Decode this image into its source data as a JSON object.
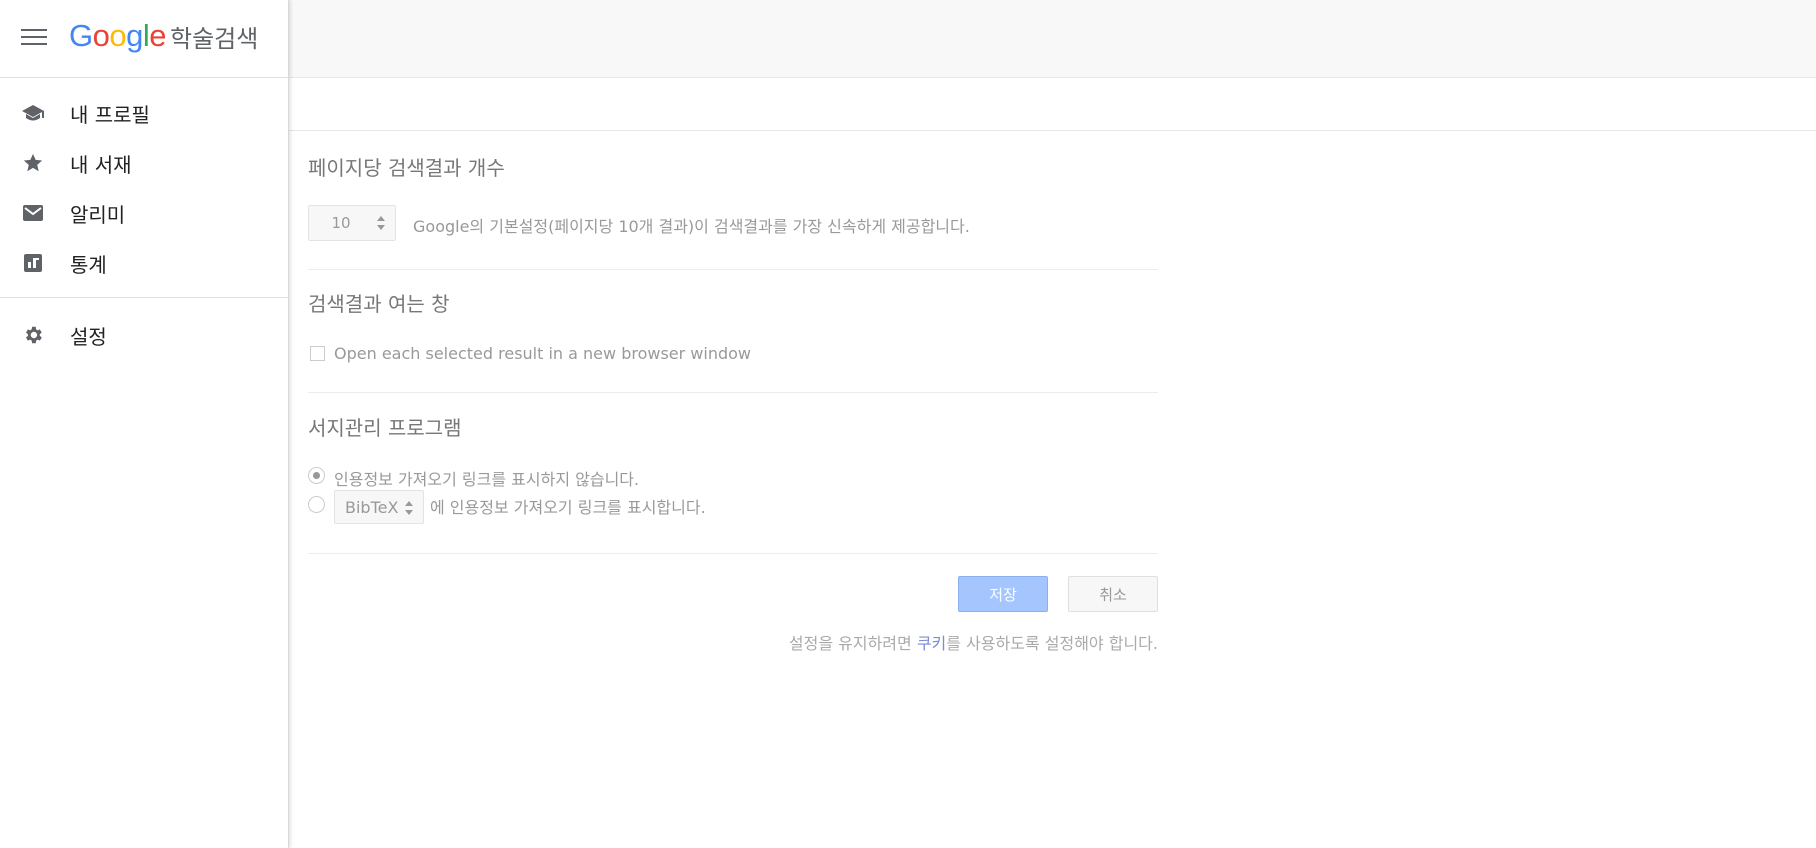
{
  "sidebar": {
    "logo": {
      "google": [
        "G",
        "o",
        "o",
        "g",
        "l",
        "e"
      ],
      "google_colors": [
        "#4285f4",
        "#ea4335",
        "#fbbc05",
        "#4285f4",
        "#34a853",
        "#ea4335"
      ],
      "product": "학술검색"
    },
    "items": [
      {
        "label": "내 프로필",
        "icon": "graduation-cap-icon"
      },
      {
        "label": "내 서재",
        "icon": "star-icon"
      },
      {
        "label": "알리미",
        "icon": "envelope-icon"
      },
      {
        "label": "통계",
        "icon": "stats-chart-icon"
      },
      {
        "label": "설정",
        "icon": "gear-icon"
      }
    ]
  },
  "settings": {
    "results_per_page": {
      "title": "페이지당 검색결과 개수",
      "value": "10",
      "description": "Google의 기본설정(페이지당 10개 결과)이 검색결과를 가장 신속하게 제공합니다."
    },
    "result_window": {
      "title": "검색결과 여는 창",
      "checkbox_label": "Open each selected result in a new browser window",
      "checked": false
    },
    "bibliography_manager": {
      "title": "서지관리 프로그램",
      "option_hide": "인용정보 가져오기 링크를 표시하지 않습니다.",
      "option_show_suffix": "에 인용정보 가져오기 링크를 표시합니다.",
      "selected_format": "BibTeX",
      "selected_option": "hide"
    },
    "save_label": "저장",
    "cancel_label": "취소",
    "footnote_before": "설정을 유지하려면 ",
    "footnote_link": "쿠키",
    "footnote_after": "를 사용하도록 설정해야 합니다."
  },
  "colors": {
    "save_button_bg": "#a5c5ff",
    "link": "#7b8cd6",
    "icon": "#5f6368"
  }
}
